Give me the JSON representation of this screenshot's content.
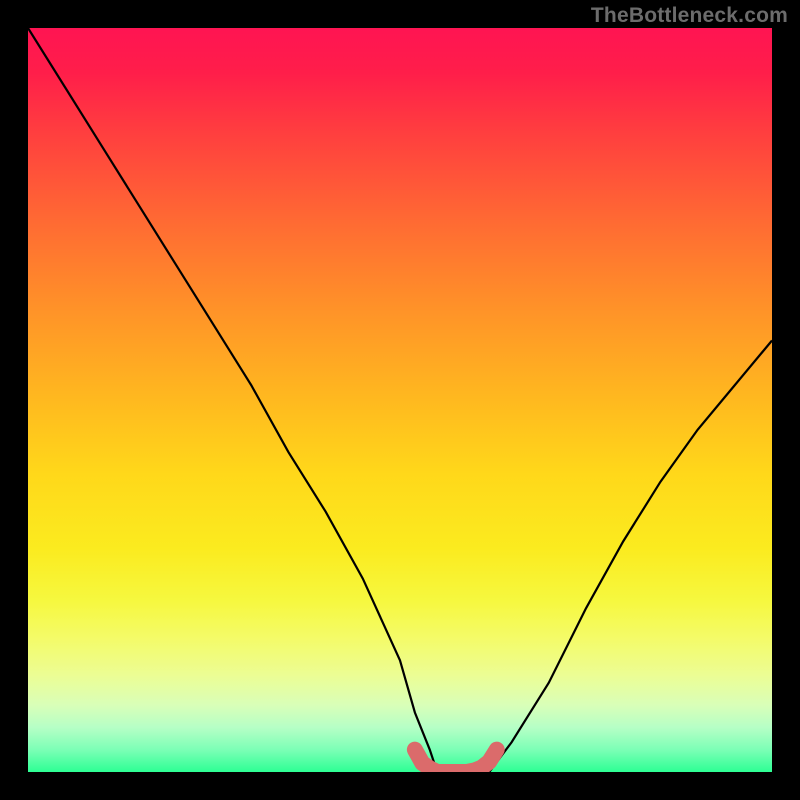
{
  "watermark": "TheBottleneck.com",
  "chart_data": {
    "type": "line",
    "title": "",
    "xlabel": "",
    "ylabel": "",
    "xlim": [
      0,
      100
    ],
    "ylim": [
      0,
      100
    ],
    "grid": false,
    "legend": false,
    "series": [
      {
        "name": "curve",
        "color": "#000000",
        "x": [
          0,
          5,
          10,
          15,
          20,
          25,
          30,
          35,
          40,
          45,
          50,
          52,
          54,
          55,
          58,
          60,
          62,
          65,
          70,
          75,
          80,
          85,
          90,
          95,
          100
        ],
        "y": [
          100,
          92,
          84,
          76,
          68,
          60,
          52,
          43,
          35,
          26,
          15,
          8,
          3,
          0,
          0,
          0,
          0,
          4,
          12,
          22,
          31,
          39,
          46,
          52,
          58
        ]
      },
      {
        "name": "flat-bottom-highlight",
        "color": "#db6b6b",
        "x": [
          52,
          53,
          54,
          55,
          56,
          57,
          58,
          59,
          60,
          61,
          62,
          63
        ],
        "y": [
          3,
          1.2,
          0.5,
          0,
          0,
          0,
          0,
          0,
          0.2,
          0.6,
          1.4,
          3
        ]
      }
    ],
    "background_gradient": {
      "top_color": "#ff1452",
      "mid_color": "#ffd81a",
      "bottom_color": "#2dff94"
    }
  }
}
